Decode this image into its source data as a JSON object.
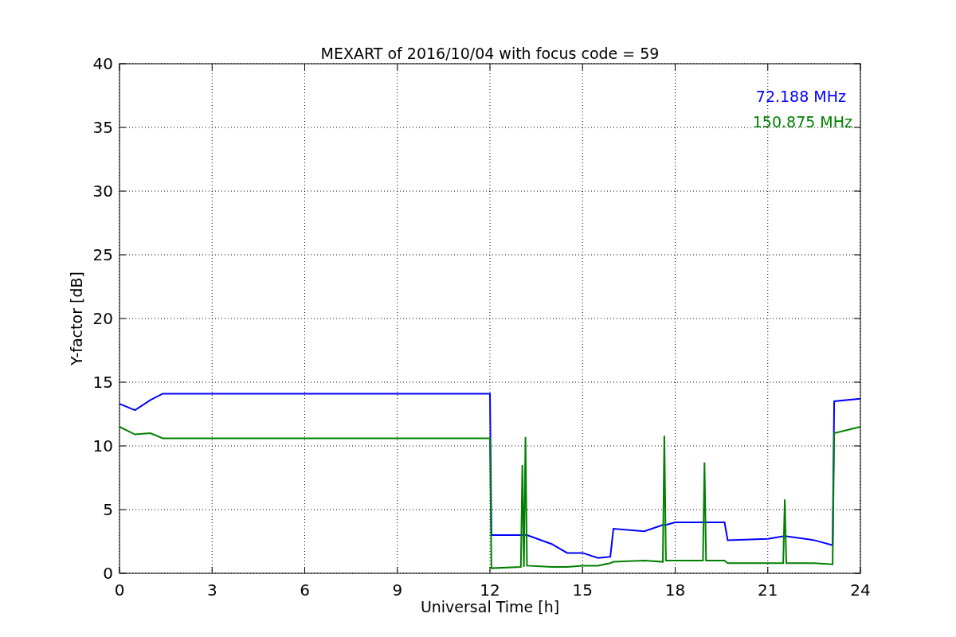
{
  "figure": {
    "chart_data": {
      "type": "line",
      "title": "MEXART of 2016/10/04 with focus code = 59",
      "xlabel": "Universal Time [h]",
      "ylabel": "Y-factor [dB]",
      "x": [
        0,
        0.5,
        1,
        1.4,
        1.5,
        12,
        12.05,
        13,
        13.05,
        13.1,
        13.15,
        13.2,
        14,
        14.5,
        15,
        15.5,
        15.9,
        16,
        17,
        17.6,
        17.65,
        17.7,
        18,
        18.9,
        18.95,
        19,
        19.6,
        19.7,
        21,
        21.5,
        21.55,
        21.6,
        22.5,
        23.1,
        23.15,
        24
      ],
      "series": [
        {
          "name": "72.188 MHz",
          "color": "#0000ff",
          "values": [
            13.3,
            12.8,
            13.6,
            14.1,
            14.1,
            14.1,
            3,
            3,
            3,
            3,
            3,
            3,
            2.3,
            1.6,
            1.6,
            1.2,
            1.3,
            3.5,
            3.3,
            3.8,
            3.8,
            3.8,
            4,
            4,
            4,
            4,
            4,
            2.6,
            2.7,
            2.9,
            2.9,
            2.9,
            2.6,
            2.2,
            13.5,
            13.7
          ]
        },
        {
          "name": "150.875 MHz",
          "color": "#008000",
          "values": [
            11.5,
            10.9,
            11,
            10.6,
            10.6,
            10.6,
            0.4,
            0.5,
            8.5,
            0.5,
            10.7,
            0.6,
            0.5,
            0.5,
            0.6,
            0.6,
            0.8,
            0.9,
            1,
            0.9,
            10.8,
            1,
            1,
            1,
            8.7,
            1,
            1,
            0.8,
            0.8,
            0.8,
            5.8,
            0.8,
            0.8,
            0.7,
            11,
            11.5
          ]
        }
      ],
      "xlim": [
        0,
        24
      ],
      "ylim": [
        0,
        40
      ],
      "grid": true,
      "xticks": [
        0,
        3,
        6,
        9,
        12,
        15,
        18,
        21,
        24
      ],
      "yticks": [
        0,
        5,
        10,
        15,
        20,
        25,
        30,
        35,
        40
      ]
    }
  }
}
